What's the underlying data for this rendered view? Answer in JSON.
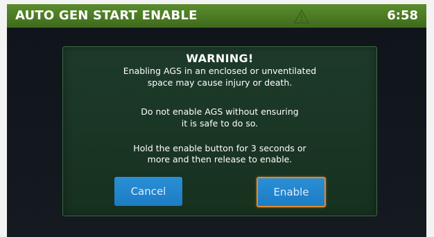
{
  "header": {
    "title": "AUTO GEN START ENABLE",
    "time": "6:58",
    "alert_icon": "warning-triangle-icon",
    "color": "#4a7a24"
  },
  "dialog": {
    "title": "WARNING!",
    "lines": [
      "Enabling AGS in an enclosed or unventilated",
      "space may cause injury or death.",
      "Do not enable AGS without ensuring",
      "it is safe to do so.",
      "Hold the enable button for 3 seconds or",
      "more and then release to enable."
    ],
    "cancel_label": "Cancel",
    "enable_label": "Enable",
    "button_color": "#2288d0",
    "focus_color": "#e48a2e"
  }
}
